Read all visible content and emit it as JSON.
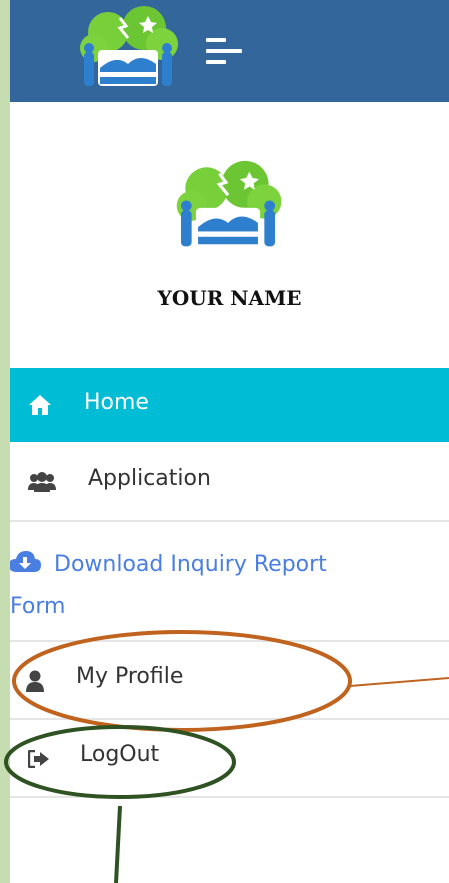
{
  "header": {
    "logo_icon": "app-logo-icon",
    "menu_icon": "hamburger-icon"
  },
  "profile": {
    "logo_icon": "app-logo-icon",
    "name": "YOUR NAME"
  },
  "nav": {
    "items": [
      {
        "label": "Home",
        "icon": "home-icon",
        "active": true
      },
      {
        "label": "Application",
        "icon": "users-icon"
      },
      {
        "label_line1": "Download Inquiry Report",
        "label_line2": "Form",
        "icon": "cloud-download-icon"
      },
      {
        "label": "My Profile",
        "icon": "user-icon"
      },
      {
        "label": "LogOut",
        "icon": "sign-out-icon"
      }
    ]
  },
  "colors": {
    "page_bg": "#c5ddb1",
    "topbar": "#33679b",
    "active_item": "#00bcd4",
    "link": "#4a7ee0",
    "annotation_orange": "#c0631f",
    "annotation_green": "#2f5222"
  }
}
